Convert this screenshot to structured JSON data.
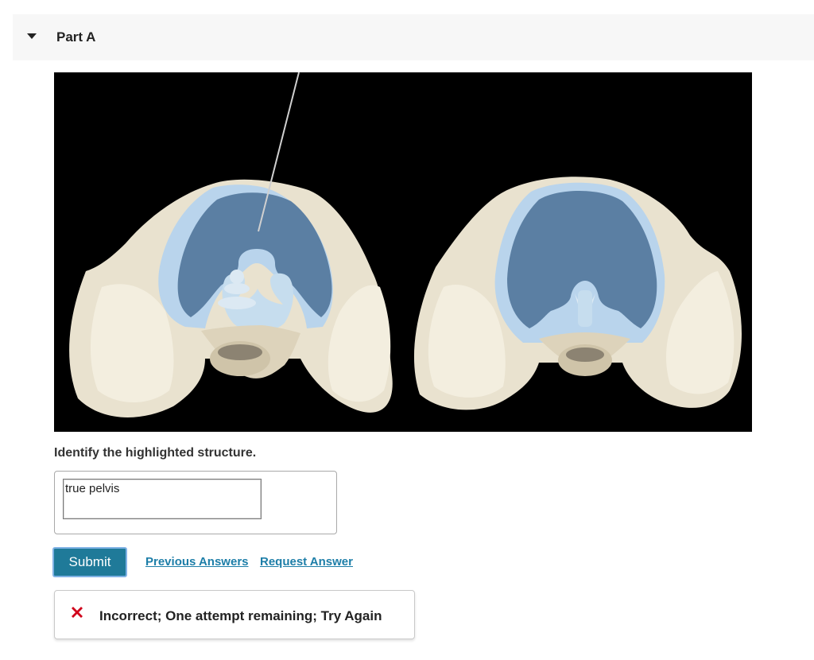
{
  "part": {
    "title": "Part A",
    "caret_icon": "caret-down-icon"
  },
  "figure": {
    "description_icon": "pelvis-anatomy-image",
    "background": "#000000",
    "highlight_color": "#5b7fa3"
  },
  "question": {
    "prompt": "Identify the highlighted structure."
  },
  "answer": {
    "value": "true pelvis"
  },
  "actions": {
    "submit_label": "Submit",
    "previous_answers_label": "Previous Answers",
    "request_answer_label": "Request Answer"
  },
  "feedback": {
    "icon": "error-x-icon",
    "message": "Incorrect; One attempt remaining; Try Again",
    "icon_color": "#d0021b"
  },
  "colors": {
    "link": "#1d7ea8",
    "submit_bg": "#1f7a99",
    "header_bg": "#f7f7f7"
  }
}
